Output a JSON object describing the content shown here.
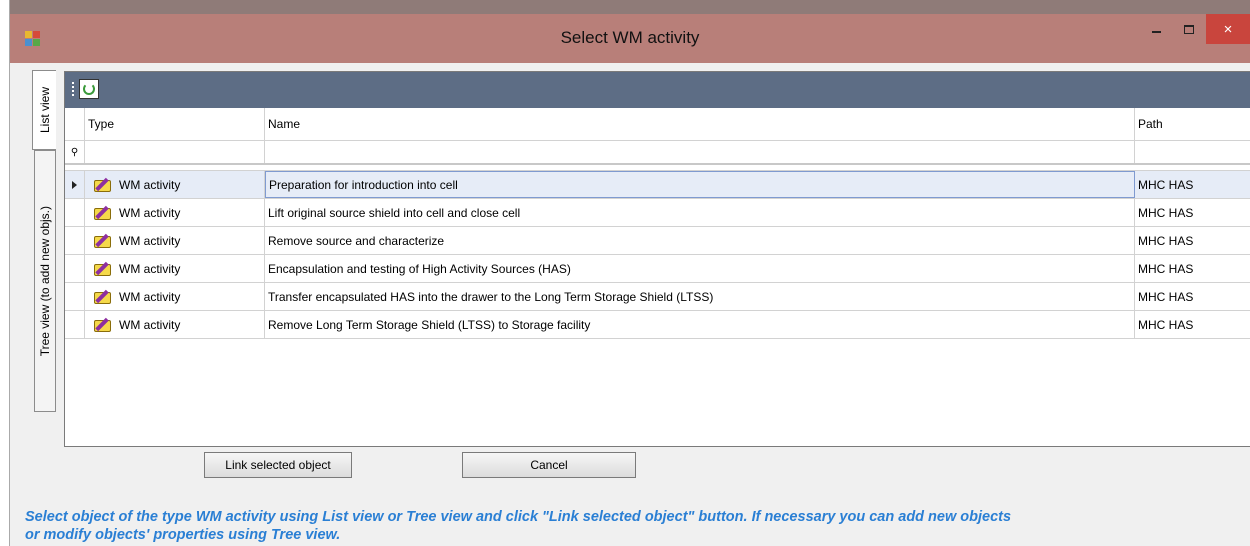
{
  "window": {
    "title": "Select WM activity",
    "close_glyph": "×"
  },
  "tabs": [
    {
      "label": "List view",
      "active": true
    },
    {
      "label": "Tree view (to add new objs.)",
      "active": false
    }
  ],
  "toolbar": {
    "refresh_icon": "refresh-icon"
  },
  "grid": {
    "columns": {
      "type": "Type",
      "name": "Name",
      "path": "Path"
    },
    "filter_glyph": "⚲",
    "rows": [
      {
        "type": "WM activity",
        "name": "Preparation for  introduction into cell",
        "path": "MHC HAS",
        "selected": true
      },
      {
        "type": "WM activity",
        "name": "Lift original source shield into cell and close cell",
        "path": "MHC HAS",
        "selected": false
      },
      {
        "type": "WM activity",
        "name": "Remove source and characterize",
        "path": "MHC HAS",
        "selected": false
      },
      {
        "type": "WM activity",
        "name": "Encapsulation and testing of High Activity Sources (HAS)",
        "path": "MHC HAS",
        "selected": false
      },
      {
        "type": "WM activity",
        "name": "Transfer encapsulated HAS into the drawer to the Long Term Storage Shield (LTSS)",
        "path": "MHC HAS",
        "selected": false
      },
      {
        "type": "WM activity",
        "name": "Remove Long Term Storage Shield (LTSS) to Storage facility",
        "path": "MHC HAS",
        "selected": false
      }
    ]
  },
  "buttons": {
    "link": "Link selected object",
    "cancel": "Cancel"
  },
  "hint": {
    "line1": "Select object of the type WM activity using List view or Tree view and click \"Link selected object\" button. If necessary you can add new objects",
    "line2": "or modify objects' properties using Tree view."
  },
  "colors": {
    "titlebar": "#b87f79",
    "toolbar": "#5d6d85",
    "hint": "#2a7fd4",
    "close": "#c9453d"
  }
}
